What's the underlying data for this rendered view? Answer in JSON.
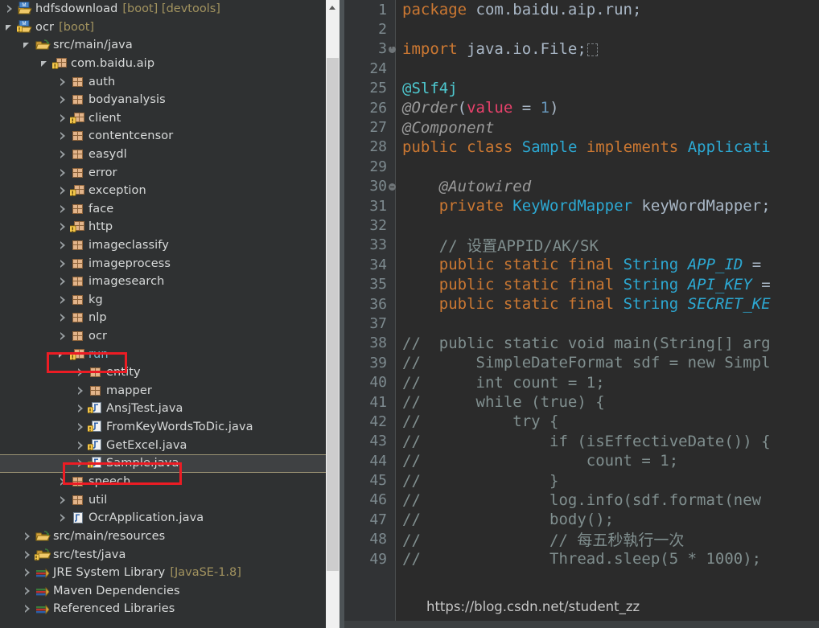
{
  "explorer": {
    "name": "package-explorer",
    "tree": [
      {
        "indent": 0,
        "arrow": "collapsed",
        "icon": "maven-project-icon",
        "label": "hdfsdownload",
        "sub": "[boot] [devtools]"
      },
      {
        "indent": 0,
        "arrow": "expanded",
        "icon": "maven-project-warning-icon",
        "label": "ocr",
        "sub": "[boot]"
      },
      {
        "indent": 1,
        "arrow": "expanded",
        "icon": "source-folder-icon",
        "label": "src/main/java",
        "sub": ""
      },
      {
        "indent": 2,
        "arrow": "expanded",
        "icon": "package-warning-icon",
        "label": "com.baidu.aip",
        "sub": ""
      },
      {
        "indent": 3,
        "arrow": "collapsed",
        "icon": "package-icon",
        "label": "auth",
        "sub": ""
      },
      {
        "indent": 3,
        "arrow": "collapsed",
        "icon": "package-icon",
        "label": "bodyanalysis",
        "sub": ""
      },
      {
        "indent": 3,
        "arrow": "collapsed",
        "icon": "package-warning-icon",
        "label": "client",
        "sub": ""
      },
      {
        "indent": 3,
        "arrow": "collapsed",
        "icon": "package-icon",
        "label": "contentcensor",
        "sub": ""
      },
      {
        "indent": 3,
        "arrow": "collapsed",
        "icon": "package-icon",
        "label": "easydl",
        "sub": ""
      },
      {
        "indent": 3,
        "arrow": "collapsed",
        "icon": "package-icon",
        "label": "error",
        "sub": ""
      },
      {
        "indent": 3,
        "arrow": "collapsed",
        "icon": "package-warning-icon",
        "label": "exception",
        "sub": ""
      },
      {
        "indent": 3,
        "arrow": "collapsed",
        "icon": "package-icon",
        "label": "face",
        "sub": ""
      },
      {
        "indent": 3,
        "arrow": "collapsed",
        "icon": "package-warning-icon",
        "label": "http",
        "sub": ""
      },
      {
        "indent": 3,
        "arrow": "collapsed",
        "icon": "package-icon",
        "label": "imageclassify",
        "sub": ""
      },
      {
        "indent": 3,
        "arrow": "collapsed",
        "icon": "package-icon",
        "label": "imageprocess",
        "sub": ""
      },
      {
        "indent": 3,
        "arrow": "collapsed",
        "icon": "package-icon",
        "label": "imagesearch",
        "sub": ""
      },
      {
        "indent": 3,
        "arrow": "collapsed",
        "icon": "package-icon",
        "label": "kg",
        "sub": ""
      },
      {
        "indent": 3,
        "arrow": "collapsed",
        "icon": "package-icon",
        "label": "nlp",
        "sub": ""
      },
      {
        "indent": 3,
        "arrow": "collapsed",
        "icon": "package-icon",
        "label": "ocr",
        "sub": ""
      },
      {
        "indent": 3,
        "arrow": "expanded",
        "icon": "package-warning-icon",
        "label": "run",
        "sub": "",
        "highlight": "cyan",
        "annotated": true
      },
      {
        "indent": 4,
        "arrow": "collapsed",
        "icon": "package-icon",
        "label": "entity",
        "sub": ""
      },
      {
        "indent": 4,
        "arrow": "collapsed",
        "icon": "package-icon",
        "label": "mapper",
        "sub": ""
      },
      {
        "indent": 4,
        "arrow": "collapsed",
        "icon": "java-warning-icon",
        "label": "AnsjTest.java",
        "sub": ""
      },
      {
        "indent": 4,
        "arrow": "collapsed",
        "icon": "java-warning-icon",
        "label": "FromKeyWordsToDic.java",
        "sub": ""
      },
      {
        "indent": 4,
        "arrow": "collapsed",
        "icon": "java-warning-icon",
        "label": "GetExcel.java",
        "sub": ""
      },
      {
        "indent": 4,
        "arrow": "collapsed",
        "icon": "java-warning-icon",
        "label": "Sample.java",
        "sub": "",
        "selected": true,
        "annotated": true
      },
      {
        "indent": 3,
        "arrow": "collapsed",
        "icon": "package-icon",
        "label": "speech",
        "sub": ""
      },
      {
        "indent": 3,
        "arrow": "collapsed",
        "icon": "package-icon",
        "label": "util",
        "sub": ""
      },
      {
        "indent": 3,
        "arrow": "collapsed",
        "icon": "java-icon",
        "label": "OcrApplication.java",
        "sub": ""
      },
      {
        "indent": 1,
        "arrow": "collapsed",
        "icon": "source-folder-icon",
        "label": "src/main/resources",
        "sub": ""
      },
      {
        "indent": 1,
        "arrow": "collapsed",
        "icon": "source-folder-warning-icon",
        "label": "src/test/java",
        "sub": ""
      },
      {
        "indent": 1,
        "arrow": "collapsed",
        "icon": "library-icon",
        "label": "JRE System Library",
        "sub": "[JavaSE-1.8]"
      },
      {
        "indent": 1,
        "arrow": "collapsed",
        "icon": "library-icon",
        "label": "Maven Dependencies",
        "sub": ""
      },
      {
        "indent": 1,
        "arrow": "collapsed",
        "icon": "library-icon",
        "label": "Referenced Libraries",
        "sub": ""
      }
    ]
  },
  "scrollbar": {
    "name": "vertical-scrollbar",
    "up_arrow": "scroll-up-arrow"
  },
  "editor": {
    "name": "java-code-editor",
    "lines": [
      {
        "no": "1",
        "fold": "",
        "text": "package com.baidu.aip.run;"
      },
      {
        "no": "2",
        "fold": "",
        "text": ""
      },
      {
        "no": "3",
        "fold": "plus",
        "text": "import java.io.File;"
      },
      {
        "no": "24",
        "fold": "",
        "text": ""
      },
      {
        "no": "25",
        "fold": "",
        "text": "@Slf4j"
      },
      {
        "no": "26",
        "fold": "",
        "text": "@Order(value = 1)"
      },
      {
        "no": "27",
        "fold": "",
        "text": "@Component"
      },
      {
        "no": "28",
        "fold": "",
        "text": "public class Sample implements Applicati"
      },
      {
        "no": "29",
        "fold": "",
        "text": ""
      },
      {
        "no": "30",
        "fold": "minus",
        "text": "    @Autowired"
      },
      {
        "no": "31",
        "fold": "",
        "text": "    private KeyWordMapper keyWordMapper;"
      },
      {
        "no": "32",
        "fold": "",
        "text": ""
      },
      {
        "no": "33",
        "fold": "",
        "text": "    // 设置APPID/AK/SK"
      },
      {
        "no": "34",
        "fold": "",
        "text": "    public static final String APP_ID ="
      },
      {
        "no": "35",
        "fold": "",
        "text": "    public static final String API_KEY ="
      },
      {
        "no": "36",
        "fold": "",
        "text": "    public static final String SECRET_KE"
      },
      {
        "no": "37",
        "fold": "",
        "text": ""
      },
      {
        "no": "38",
        "fold": "",
        "text": "//  public static void main(String[] arg"
      },
      {
        "no": "39",
        "fold": "",
        "text": "//      SimpleDateFormat sdf = new Simpl"
      },
      {
        "no": "40",
        "fold": "",
        "text": "//      int count = 1;"
      },
      {
        "no": "41",
        "fold": "",
        "text": "//      while (true) {"
      },
      {
        "no": "42",
        "fold": "",
        "text": "//          try {"
      },
      {
        "no": "43",
        "fold": "",
        "text": "//              if (isEffectiveDate()) {"
      },
      {
        "no": "44",
        "fold": "",
        "text": "//                  count = 1;"
      },
      {
        "no": "45",
        "fold": "",
        "text": "//              }"
      },
      {
        "no": "46",
        "fold": "",
        "text": "//              log.info(sdf.format(new"
      },
      {
        "no": "47",
        "fold": "",
        "text": "//              body();"
      },
      {
        "no": "48",
        "fold": "",
        "text": "//              // 每五秒執行一次"
      },
      {
        "no": "49",
        "fold": "",
        "text": "//              Thread.sleep(5 * 1000);"
      }
    ]
  },
  "watermark": {
    "name": "csdn-blog-watermark",
    "text": "https://blog.csdn.net/student_zz"
  }
}
